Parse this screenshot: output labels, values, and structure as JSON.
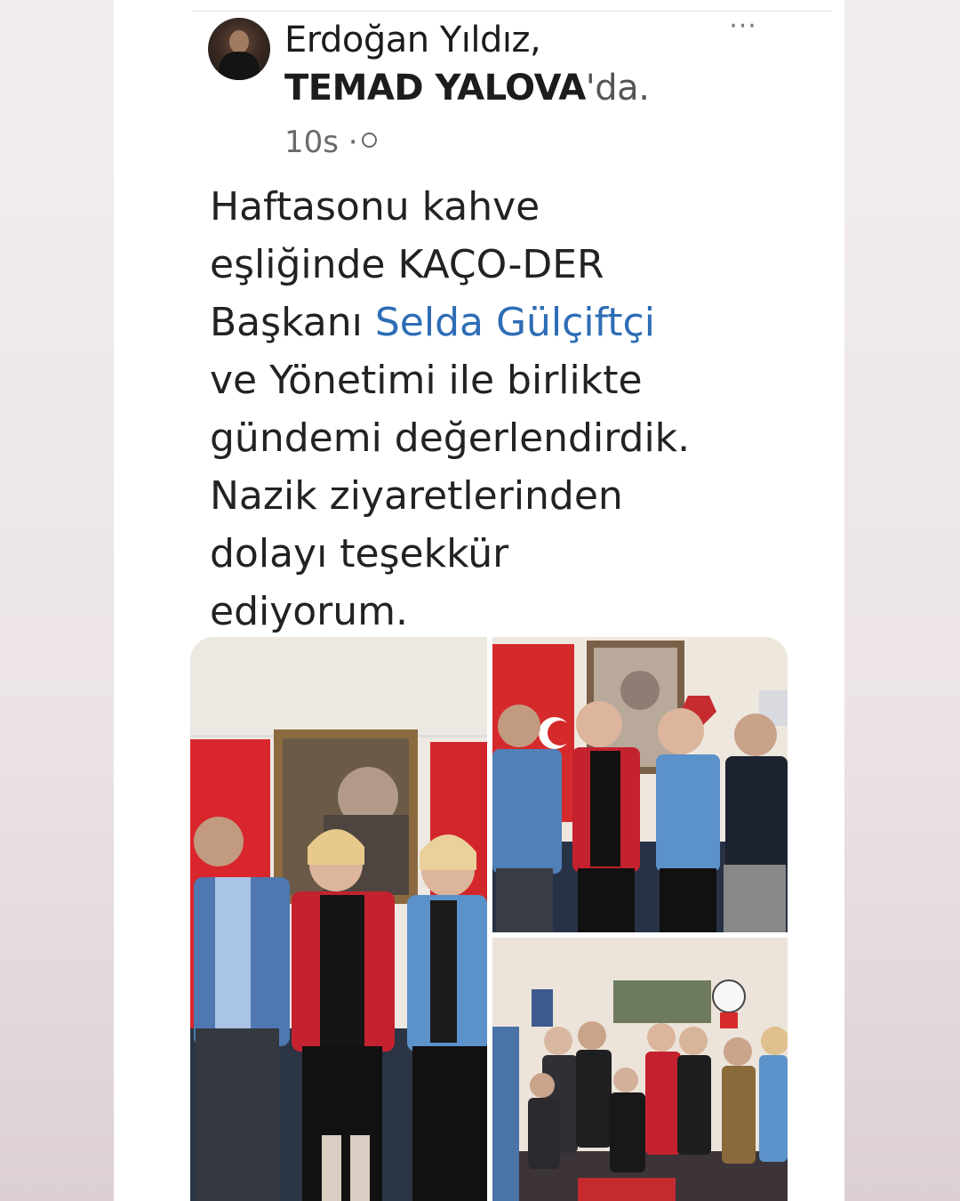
{
  "post": {
    "author_name": "Erdoğan Yıldız",
    "author_sep": ",",
    "group_name": "TEMAD YALOVA",
    "group_suffix": "'da.",
    "time": "10s",
    "dot": "·",
    "more_label": "···",
    "text_lines": [
      "Haftasonu kahve",
      "eşliğinde KAÇO-DER",
      "Başkanı ",
      "ve Yönetimi ile birlikte",
      "gündemi değerlendirdik.",
      "Nazik ziyaretlerinden",
      "dolayı teşekkür",
      "ediyorum."
    ],
    "mention": "Selda Gülçiftçi"
  },
  "colors": {
    "mention": "#2d6db5",
    "flag_red": "#d62828",
    "jacket_red": "#c4222e",
    "jacket_blue": "#5b91c8"
  },
  "icons": [
    "avatar",
    "more-icon",
    "globe-icon"
  ]
}
